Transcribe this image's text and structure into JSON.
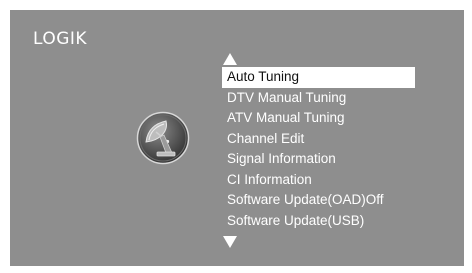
{
  "brand": {
    "logo_text": "LOGIK"
  },
  "menu": {
    "icon": "satellite-dish-icon",
    "scroll_up_icon": "triangle-up-icon",
    "scroll_down_icon": "triangle-down-icon",
    "selected_index": 0,
    "items": [
      {
        "label": "Auto Tuning"
      },
      {
        "label": "DTV Manual Tuning"
      },
      {
        "label": "ATV Manual Tuning"
      },
      {
        "label": "Channel Edit"
      },
      {
        "label": "Signal Information"
      },
      {
        "label": "CI Information"
      },
      {
        "label": "Software Update(OAD)Off"
      },
      {
        "label": "Software Update(USB)"
      }
    ]
  },
  "colors": {
    "screen_background": "#8e8e8e",
    "text": "#ffffff",
    "highlight_background": "#ffffff",
    "highlight_text": "#111111"
  }
}
